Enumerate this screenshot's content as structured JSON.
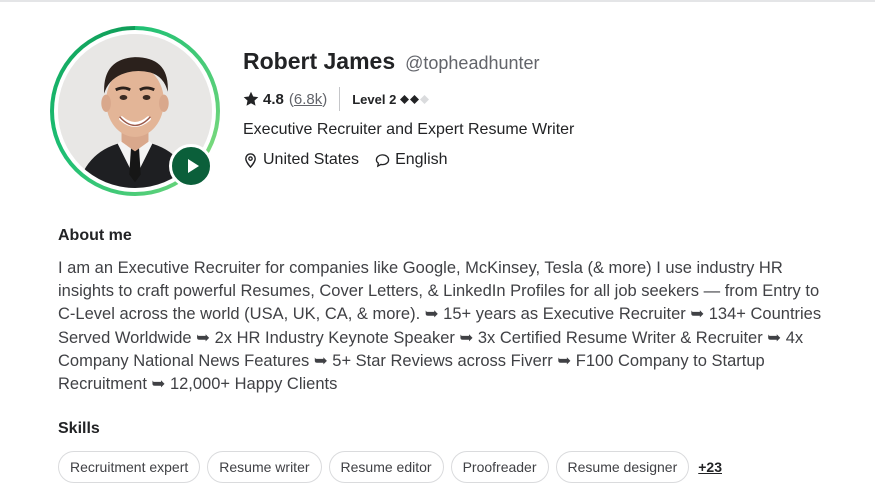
{
  "profile": {
    "name": "Robert James",
    "handle": "@topheadhunter",
    "rating": "4.8",
    "reviews_open": "(",
    "reviews_count": "6.8k",
    "reviews_close": ")",
    "level_label": "Level 2",
    "level_filled": 2,
    "level_total": 3,
    "tagline": "Executive Recruiter and Expert Resume Writer",
    "location": "United States",
    "language": "English"
  },
  "about": {
    "title": "About me",
    "text": "I am an Executive Recruiter for companies like Google, McKinsey, Tesla (& more) I use industry HR insights to craft powerful Resumes, Cover Letters, & LinkedIn Profiles for all job seekers — from Entry to C-Level across the world (USA, UK, CA, & more). ➥ 15+ years as Executive Recruiter ➥ 134+ Countries Served Worldwide ➥ 2x HR Industry Keynote Speaker ➥ 3x Certified Resume Writer & Recruiter ➥ 4x Company National News Features ➥ 5+ Star Reviews across Fiverr ➥ F100 Company to Startup Recruitment ➥ 12,000+ Happy Clients"
  },
  "skills": {
    "title": "Skills",
    "items": [
      "Recruitment expert",
      "Resume writer",
      "Resume editor",
      "Proofreader",
      "Resume designer"
    ],
    "more": "+23"
  },
  "colors": {
    "accent": "#1dbf73",
    "play_button": "#0b5f3a",
    "text_primary": "#222325",
    "text_secondary": "#62646a"
  },
  "icons": [
    "star-icon",
    "diamond-icon",
    "location-pin-icon",
    "speech-bubble-icon",
    "play-icon"
  ]
}
